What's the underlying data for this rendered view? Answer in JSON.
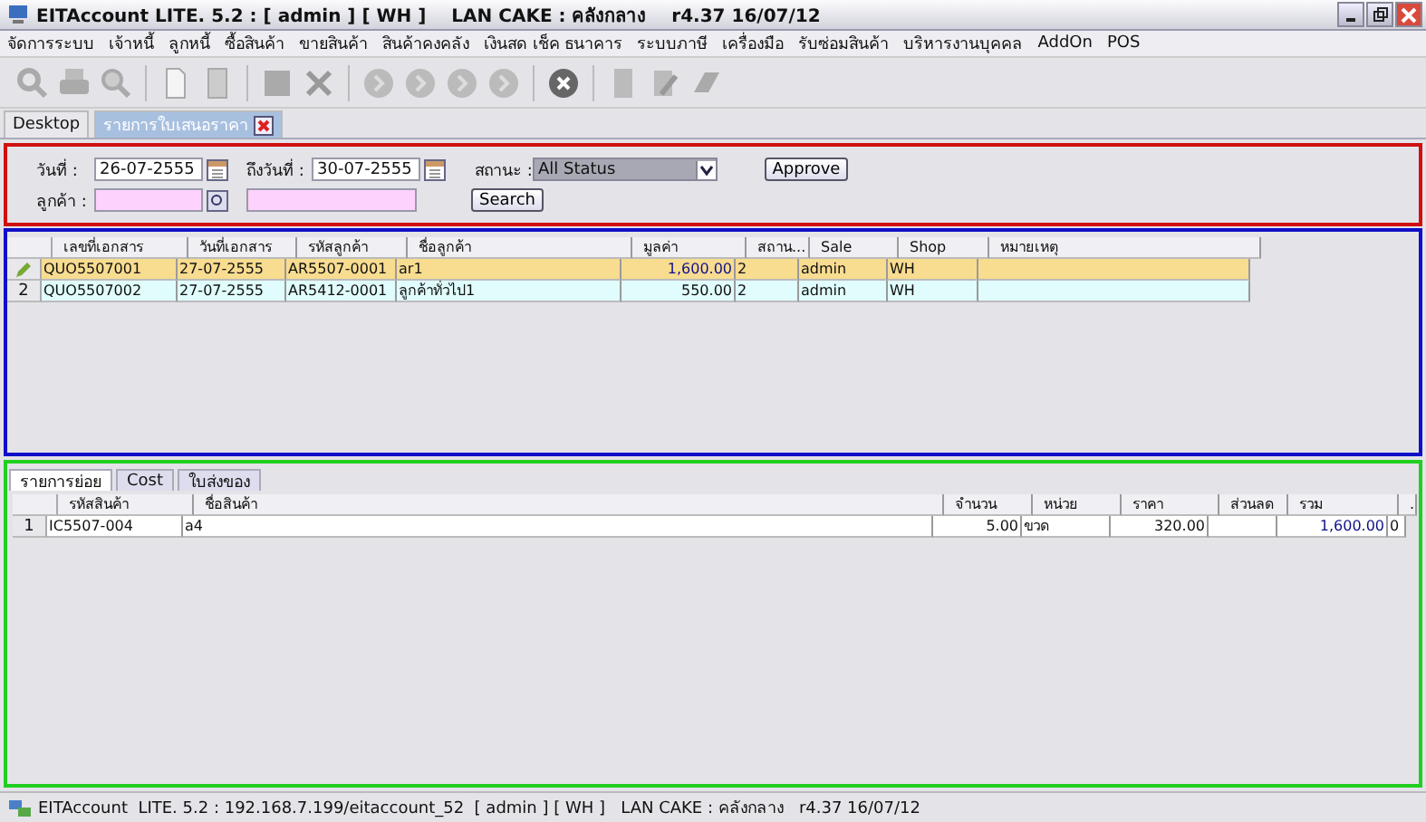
{
  "window": {
    "title": "EITAccount LITE. 5.2 : [ admin ] [ WH ]    LAN CAKE : คลังกลาง    r4.37 16/07/12"
  },
  "menu": [
    "จัดการระบบ",
    "เจ้าหนี้",
    "ลูกหนี้",
    "ซื้อสินค้า",
    "ขายสินค้า",
    "สินค้าคงคลัง",
    "เงินสด เช็ค ธนาคาร",
    "ระบบภาษี",
    "เครื่องมือ",
    "รับซ่อมสินค้า",
    "บริหารงานบุคคล",
    "AddOn",
    "POS"
  ],
  "tabs": [
    {
      "label": "Desktop",
      "selected": false,
      "closable": false
    },
    {
      "label": "รายการใบเสนอราคา",
      "selected": true,
      "closable": true
    }
  ],
  "filter": {
    "date_from_label": "วันที่ :",
    "date_from": "26-07-2555",
    "date_to_label": "ถึงวันที่ :",
    "date_to": "30-07-2555",
    "status_label": "สถานะ :",
    "status": "All Status",
    "approve_button": "Approve",
    "customer_label": "ลูกค้า :",
    "search_button": "Search"
  },
  "table": {
    "columns": [
      "เลขที่เอกสาร",
      "วันที่เอกสาร",
      "รหัสลูกค้า",
      "ชื่อลูกค้า",
      "มูลค่า",
      "สถาน...",
      "Sale",
      "Shop",
      "หมายเหตุ"
    ],
    "rows": [
      {
        "selected": true,
        "row_header": "",
        "cells": [
          "QUO5507001",
          "27-07-2555",
          "AR5507-0001",
          "ar1",
          "1,600.00",
          "2",
          "admin",
          "WH",
          ""
        ]
      },
      {
        "selected": false,
        "row_header": "2",
        "cells": [
          "QUO5507002",
          "27-07-2555",
          "AR5412-0001",
          "ลูกค้าทั่วไป1",
          "550.00",
          "2",
          "admin",
          "WH",
          ""
        ]
      }
    ]
  },
  "detail_tabs": [
    {
      "label": "รายการย่อย",
      "selected": true
    },
    {
      "label": "Cost",
      "selected": false
    },
    {
      "label": "ใบส่งของ",
      "selected": false
    }
  ],
  "detail_table": {
    "columns": [
      "รหัสสินค้า",
      "ชื่อสินค้า",
      "จำนวน",
      "หน่วย",
      "ราคา",
      "ส่วนลด",
      "รวม",
      "."
    ],
    "rows": [
      {
        "row_header": "1",
        "cells": [
          "IC5507-004",
          "a4",
          "5.00",
          "ขวด",
          "320.00",
          "",
          "1,600.00",
          "0"
        ]
      }
    ]
  },
  "status_bar": "EITAccount  LITE. 5.2 : 192.168.7.199/eitaccount_52  [ admin ] [ WH ]   LAN CAKE : คลังกลาง   r4.37 16/07/12"
}
